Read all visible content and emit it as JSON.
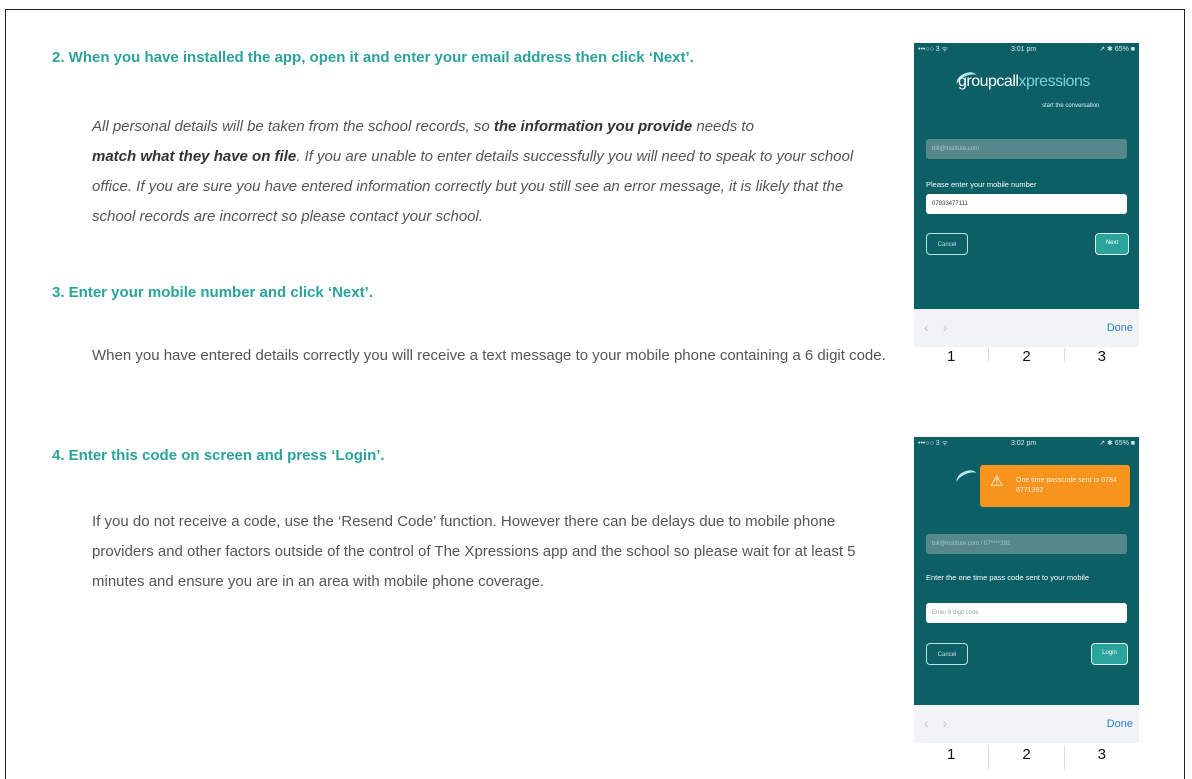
{
  "steps": [
    {
      "heading": "2.  When you have installed the app, open it and enter your email address then click ‘Next’.",
      "para": {
        "t1": "All personal details will be taken from the school records, so ",
        "b1": "the information you provide",
        "t2": " needs to",
        "b2": "match what they have on file",
        "t3": ". If you are unable to enter details successfully you will need to speak to your school office. If you are sure you have entered information correctly but you still see an error message, it is likely that the school records are incorrect so please contact your school."
      }
    },
    {
      "heading": "3.  Enter your mobile number and click ‘Next’.",
      "para": "When you have entered details correctly you will receive a text message to your mobile phone containing a 6 digit code."
    },
    {
      "heading": "4.  Enter this code on screen and press ‘Login’.",
      "para": "If you do not receive a code, use the ‘Resend Code’ function. However there can be delays due to mobile phone providers and other factors outside of the control of The Xpressions app and the school so please wait for at least 5 minutes and ensure you are in an area with mobile phone coverage."
    }
  ],
  "phone1": {
    "status_left": "•••○○ 3 ᯤ",
    "time": "3:01 pm",
    "status_right": "↗ ✱ 65% ■",
    "logo_bold": "groupcall",
    "logo_light": "xpressions",
    "tagline": "start the conversation",
    "email_value": "bill@institute.com",
    "prompt": "Please enter your mobile number",
    "mobile_value": "07933477111",
    "cancel": "Cancel",
    "next": "Next",
    "done": "Done",
    "keys": [
      "1",
      "2",
      "3"
    ]
  },
  "phone2": {
    "status_left": "•••○○ 3 ᯤ",
    "time": "3:02 pm",
    "status_right": "↗ ✱ 65% ■",
    "toast": "One time passcode sent to 0784 6771392",
    "email_value": "bill@institute.com / 07****392",
    "prompt": "Enter the one time pass code sent to your mobile",
    "code_placeholder": "Enter 6 digit code",
    "cancel": "Cancel",
    "login": "Login",
    "done": "Done",
    "keys": [
      "1",
      "2",
      "3"
    ]
  }
}
